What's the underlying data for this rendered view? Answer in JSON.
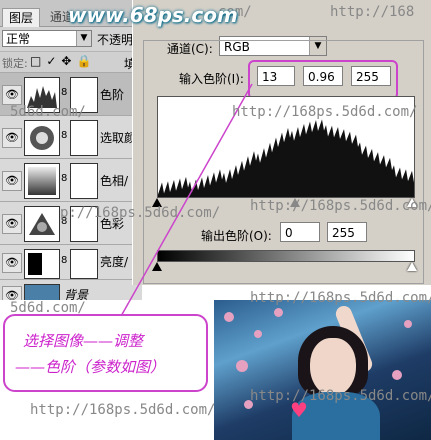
{
  "layers_panel": {
    "tabs": [
      "图层",
      "通道"
    ],
    "blend_mode": "正常",
    "opacity_label": "不透明",
    "lock_label": "锁定:",
    "lock_icons": "□✓✥🔒",
    "fill_label": "填",
    "layers": [
      {
        "name": "色阶",
        "selected": true
      },
      {
        "name": "选取颜"
      },
      {
        "name": "色相/"
      },
      {
        "name": "色彩"
      },
      {
        "name": "亮度/"
      },
      {
        "name": "背景"
      }
    ]
  },
  "levels_dialog": {
    "channel_label": "通道(C):",
    "channel_value": "RGB",
    "input_label": "输入色阶(I):",
    "input_values": [
      "13",
      "0.96",
      "255"
    ],
    "output_label": "输出色阶(O):",
    "output_values": [
      "0",
      "255"
    ]
  },
  "logo": "www.68ps.com",
  "watermarks": [
    "http://168",
    "http://168ps.5d6d.com/",
    "http://168ps.5d6d.com/",
    "5d6d.com/",
    "p://168ps.5d6d.com/",
    "http://168ps.5d6d.com/",
    "5d6d.com/",
    "http://168ps.5d6d.com/",
    "http://168ps.5d6d.com/",
    "com/"
  ],
  "callout": {
    "line1": "选择图像——调整",
    "line2": "——色阶（参数如图）"
  },
  "colors": {
    "highlight": "#cc44cc",
    "logo": "#0a6b8a"
  },
  "icons": [
    "eye-icon",
    "chain-icon",
    "dropdown-arrow-icon",
    "slider-triangle-icon"
  ]
}
